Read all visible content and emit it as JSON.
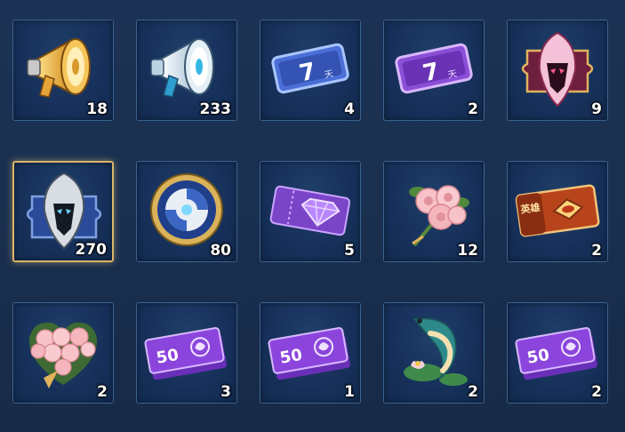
{
  "inventory": {
    "items": [
      {
        "icon": "gold-megaphone-icon",
        "count": "18"
      },
      {
        "icon": "silver-megaphone-icon",
        "count": "233"
      },
      {
        "icon": "blue-7-day-card-icon",
        "count": "4",
        "label": "7",
        "sub": "天"
      },
      {
        "icon": "purple-7-day-card-icon",
        "count": "2",
        "label": "7",
        "sub": "天"
      },
      {
        "icon": "pink-puzzle-helmet-icon",
        "count": "9"
      },
      {
        "icon": "silver-puzzle-helmet-icon",
        "count": "270"
      },
      {
        "icon": "gold-medallion-icon",
        "count": "80"
      },
      {
        "icon": "purple-diamond-ticket-icon",
        "count": "5"
      },
      {
        "icon": "rose-bouquet-icon",
        "count": "12"
      },
      {
        "icon": "hero-ticket-icon",
        "count": "2",
        "label": "英雄"
      },
      {
        "icon": "rose-heart-icon",
        "count": "2"
      },
      {
        "icon": "purple-50-ticket-icon",
        "count": "3",
        "label": "50"
      },
      {
        "icon": "purple-50-ticket-icon",
        "count": "1",
        "label": "50"
      },
      {
        "icon": "koi-lotus-icon",
        "count": "2"
      },
      {
        "icon": "purple-50-ticket-icon",
        "count": "2",
        "label": "50"
      }
    ],
    "selected_index": 5
  },
  "colors": {
    "background": "#1a3050",
    "slot": "#16305a",
    "border": "#3b6390",
    "selected_border": "#d9b56a"
  }
}
